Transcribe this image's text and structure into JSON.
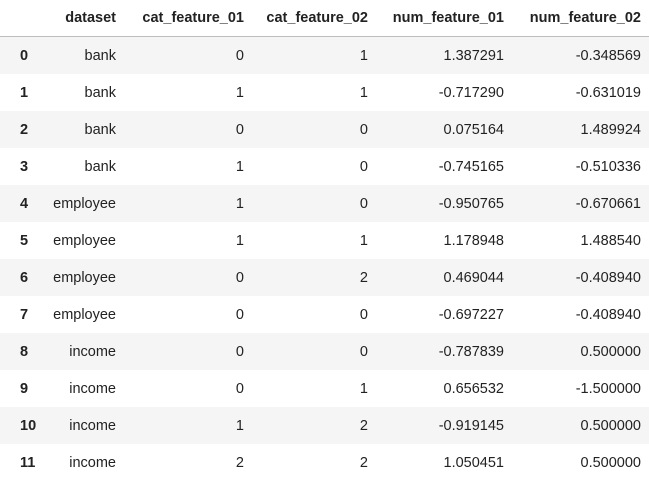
{
  "table": {
    "columns": [
      "",
      "dataset",
      "cat_feature_01",
      "cat_feature_02",
      "num_feature_01",
      "num_feature_02"
    ],
    "rows": [
      {
        "index": "0",
        "dataset": "bank",
        "cat_feature_01": "0",
        "cat_feature_02": "1",
        "num_feature_01": "1.387291",
        "num_feature_02": "-0.348569"
      },
      {
        "index": "1",
        "dataset": "bank",
        "cat_feature_01": "1",
        "cat_feature_02": "1",
        "num_feature_01": "-0.717290",
        "num_feature_02": "-0.631019"
      },
      {
        "index": "2",
        "dataset": "bank",
        "cat_feature_01": "0",
        "cat_feature_02": "0",
        "num_feature_01": "0.075164",
        "num_feature_02": "1.489924"
      },
      {
        "index": "3",
        "dataset": "bank",
        "cat_feature_01": "1",
        "cat_feature_02": "0",
        "num_feature_01": "-0.745165",
        "num_feature_02": "-0.510336"
      },
      {
        "index": "4",
        "dataset": "employee",
        "cat_feature_01": "1",
        "cat_feature_02": "0",
        "num_feature_01": "-0.950765",
        "num_feature_02": "-0.670661"
      },
      {
        "index": "5",
        "dataset": "employee",
        "cat_feature_01": "1",
        "cat_feature_02": "1",
        "num_feature_01": "1.178948",
        "num_feature_02": "1.488540"
      },
      {
        "index": "6",
        "dataset": "employee",
        "cat_feature_01": "0",
        "cat_feature_02": "2",
        "num_feature_01": "0.469044",
        "num_feature_02": "-0.408940"
      },
      {
        "index": "7",
        "dataset": "employee",
        "cat_feature_01": "0",
        "cat_feature_02": "0",
        "num_feature_01": "-0.697227",
        "num_feature_02": "-0.408940"
      },
      {
        "index": "8",
        "dataset": "income",
        "cat_feature_01": "0",
        "cat_feature_02": "0",
        "num_feature_01": "-0.787839",
        "num_feature_02": "0.500000"
      },
      {
        "index": "9",
        "dataset": "income",
        "cat_feature_01": "0",
        "cat_feature_02": "1",
        "num_feature_01": "0.656532",
        "num_feature_02": "-1.500000"
      },
      {
        "index": "10",
        "dataset": "income",
        "cat_feature_01": "1",
        "cat_feature_02": "2",
        "num_feature_01": "-0.919145",
        "num_feature_02": "0.500000"
      },
      {
        "index": "11",
        "dataset": "income",
        "cat_feature_01": "2",
        "cat_feature_02": "2",
        "num_feature_01": "1.050451",
        "num_feature_02": "0.500000"
      }
    ]
  },
  "colors": {
    "striped_row": "#f5f5f5",
    "header_border": "#bdbdbd",
    "text": "#222222"
  }
}
